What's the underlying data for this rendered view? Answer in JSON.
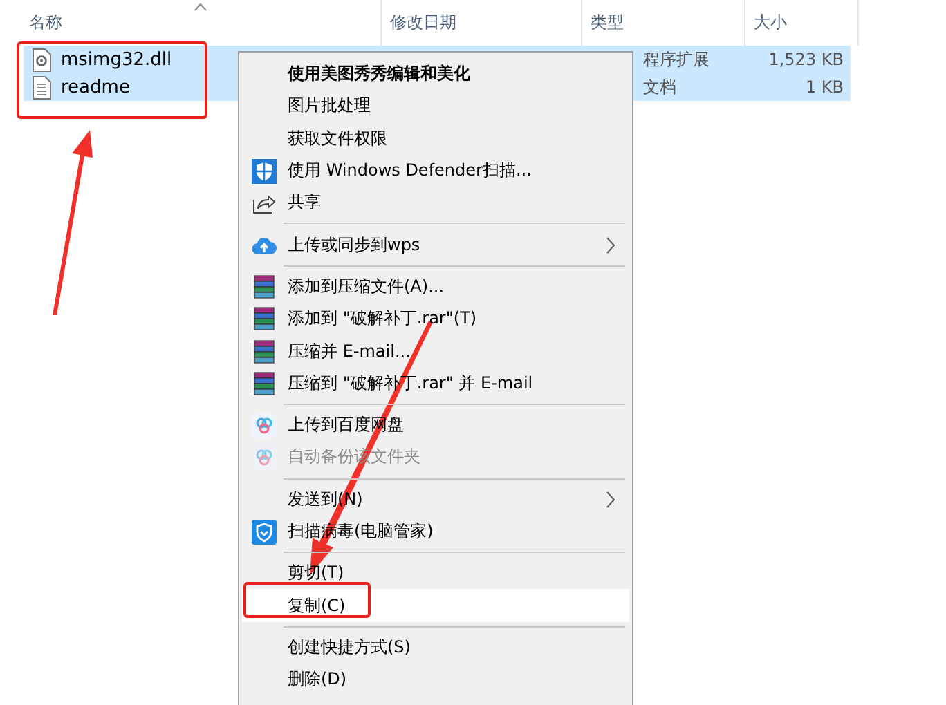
{
  "columns": [
    {
      "label": "名称",
      "sorted": true
    },
    {
      "label": "修改日期",
      "sorted": false
    },
    {
      "label": "类型",
      "sorted": false
    },
    {
      "label": "大小",
      "sorted": false
    }
  ],
  "files": [
    {
      "kind": "dll",
      "name": "msimg32.dll",
      "type": "程序扩展",
      "size": "1,523 KB",
      "selected": true
    },
    {
      "kind": "text",
      "name": "readme",
      "type": "文档",
      "size": "1 KB",
      "selected": true
    }
  ],
  "menu": [
    {
      "kind": "plain",
      "label": "使用美图秀秀编辑和美化",
      "bold": true,
      "disabled": false,
      "submenu": false,
      "selected": false
    },
    {
      "kind": "plain",
      "label": "图片批处理",
      "bold": false,
      "disabled": false,
      "submenu": false,
      "selected": false
    },
    {
      "kind": "plain",
      "label": "获取文件权限",
      "bold": false,
      "disabled": false,
      "submenu": false,
      "selected": false
    },
    {
      "kind": "shield",
      "label": "使用 Windows Defender扫描...",
      "bold": false,
      "disabled": false,
      "submenu": false,
      "selected": false
    },
    {
      "kind": "share",
      "label": "共享",
      "bold": false,
      "disabled": false,
      "submenu": false,
      "selected": false
    },
    {
      "kind": "separator"
    },
    {
      "kind": "cloud",
      "label": "上传或同步到wps",
      "bold": false,
      "disabled": false,
      "submenu": true,
      "selected": false
    },
    {
      "kind": "separator"
    },
    {
      "kind": "archive",
      "label": "添加到压缩文件(A)...",
      "bold": false,
      "disabled": false,
      "submenu": false,
      "selected": false
    },
    {
      "kind": "archive",
      "label": "添加到 \"破解补丁.rar\"(T)",
      "bold": false,
      "disabled": false,
      "submenu": false,
      "selected": false
    },
    {
      "kind": "archive",
      "label": "压缩并 E-mail...",
      "bold": false,
      "disabled": false,
      "submenu": false,
      "selected": false
    },
    {
      "kind": "archive",
      "label": "压缩到 \"破解补丁.rar\" 并 E-mail",
      "bold": false,
      "disabled": false,
      "submenu": false,
      "selected": false
    },
    {
      "kind": "separator"
    },
    {
      "kind": "rings",
      "label": "上传到百度网盘",
      "bold": false,
      "disabled": false,
      "submenu": false,
      "selected": false
    },
    {
      "kind": "rings",
      "label": "自动备份该文件夹",
      "bold": false,
      "disabled": true,
      "submenu": false,
      "selected": false
    },
    {
      "kind": "separator"
    },
    {
      "kind": "plain",
      "label": "发送到(N)",
      "bold": false,
      "disabled": false,
      "submenu": true,
      "selected": false
    },
    {
      "kind": "badge",
      "label": "扫描病毒(电脑管家)",
      "bold": false,
      "disabled": false,
      "submenu": false,
      "selected": false
    },
    {
      "kind": "separator"
    },
    {
      "kind": "plain",
      "label": "剪切(T)",
      "bold": false,
      "disabled": false,
      "submenu": false,
      "selected": false
    },
    {
      "kind": "plain",
      "label": "复制(C)",
      "bold": false,
      "disabled": false,
      "submenu": false,
      "selected": true
    },
    {
      "kind": "separator"
    },
    {
      "kind": "plain",
      "label": "创建快捷方式(S)",
      "bold": false,
      "disabled": false,
      "submenu": false,
      "selected": false
    },
    {
      "kind": "plain",
      "label": "删除(D)",
      "bold": false,
      "disabled": false,
      "submenu": false,
      "selected": false
    }
  ]
}
